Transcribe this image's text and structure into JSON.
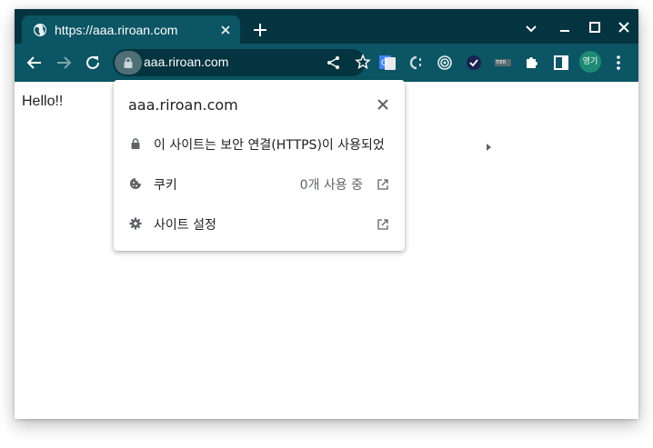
{
  "tab": {
    "title": "https://aaa.riroan.com"
  },
  "toolbar": {
    "url": "aaa.riroan.com",
    "profile_label": "영기",
    "extension_tier_label": "TIER"
  },
  "page": {
    "text": "Hello!!"
  },
  "site_info": {
    "title": "aaa.riroan.com",
    "connection_label": "이 사이트는 보안 연결(HTTPS)이 사용되었",
    "cookies_label": "쿠키",
    "cookies_value": "0개 사용 중",
    "site_settings_label": "사이트 설정"
  },
  "colors": {
    "tabstrip": "#04343f",
    "toolbar": "#0b5564",
    "avatar": "#1c8a74"
  },
  "icons": [
    "globe-icon",
    "close-icon",
    "plus-icon",
    "chevron-down-icon",
    "minimize-icon",
    "maximize-icon",
    "back-icon",
    "forward-icon",
    "reload-icon",
    "lock-icon",
    "share-icon",
    "star-icon",
    "google-translate-icon",
    "extension-icon",
    "target-icon",
    "check-icon",
    "puzzle-icon",
    "side-panel-icon",
    "more-icon",
    "cookie-icon",
    "gear-icon",
    "external-link-icon",
    "caret-right-icon"
  ]
}
